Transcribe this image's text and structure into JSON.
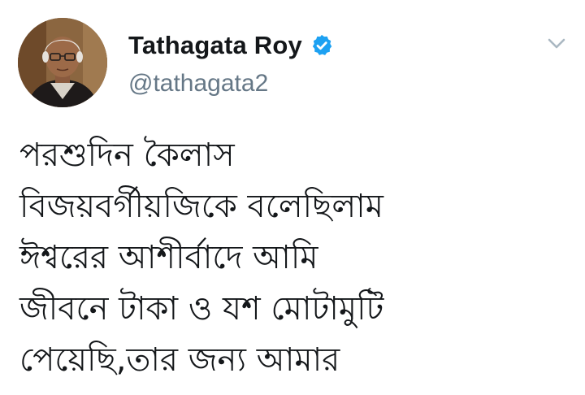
{
  "tweet": {
    "author": {
      "display_name": "Tathagata Roy",
      "handle": "@tathagata2",
      "verified": true,
      "avatar_icon": "profile-photo"
    },
    "menu_icon": "chevron-down-icon",
    "text_lines": [
      "পরশুদিন কৈলাস",
      "বিজয়বর্গীয়জিকে বলেছিলাম",
      "ঈশ্বরের আশীর্বাদে আমি",
      "জীবনে টাকা ও যশ মোটামুটি",
      "পেয়েছি,তার জন্য আমার"
    ]
  },
  "colors": {
    "verified_blue": "#1da1f2",
    "handle_gray": "#657786",
    "text": "#14171a",
    "caret_gray": "#aab8c2"
  }
}
